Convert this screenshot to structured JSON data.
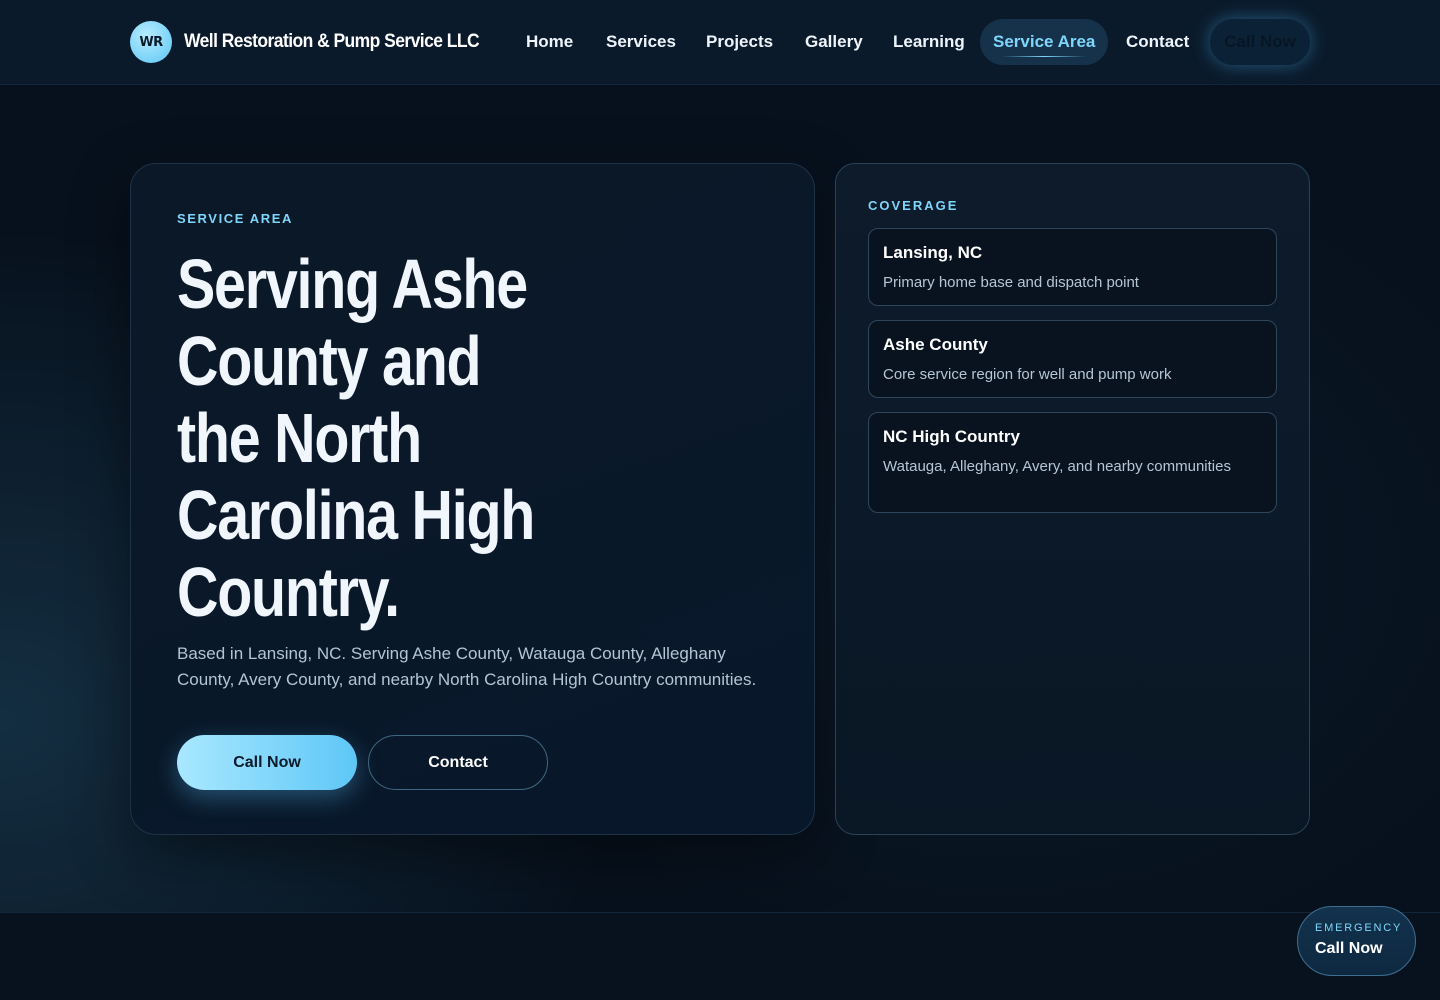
{
  "header": {
    "logo_initials": "WR",
    "brand_name": "Well Restoration & Pump Service LLC",
    "nav": [
      {
        "label": "Home"
      },
      {
        "label": "Services"
      },
      {
        "label": "Projects"
      },
      {
        "label": "Gallery"
      },
      {
        "label": "Learning"
      },
      {
        "label": "Service Area",
        "active": true
      },
      {
        "label": "Contact"
      }
    ],
    "call_label": "Call Now"
  },
  "hero": {
    "eyebrow": "SERVICE AREA",
    "headline_lines": [
      "Serving Ashe",
      "County and",
      "the North",
      "Carolina High",
      "Country."
    ],
    "description": "Based in Lansing, NC. Serving Ashe County, Watauga County, Alleghany County, Avery County, and nearby North Carolina High Country communities.",
    "primary_button": "Call Now",
    "secondary_button": "Contact"
  },
  "coverage": {
    "eyebrow": "COVERAGE",
    "items": [
      {
        "title": "Lansing, NC",
        "description": "Primary home base and dispatch point"
      },
      {
        "title": "Ashe County",
        "description": "Core service region for well and pump work"
      },
      {
        "title": "NC High Country",
        "description": "Watauga, Alleghany, Avery, and nearby communities"
      }
    ]
  },
  "emergency": {
    "label": "EMERGENCY",
    "call_label": "Call Now"
  },
  "colors": {
    "background": "#07111d",
    "accent": "#7fd6fb",
    "button_gradient_start": "#a9e8ff",
    "button_gradient_end": "#5ec7f6"
  }
}
